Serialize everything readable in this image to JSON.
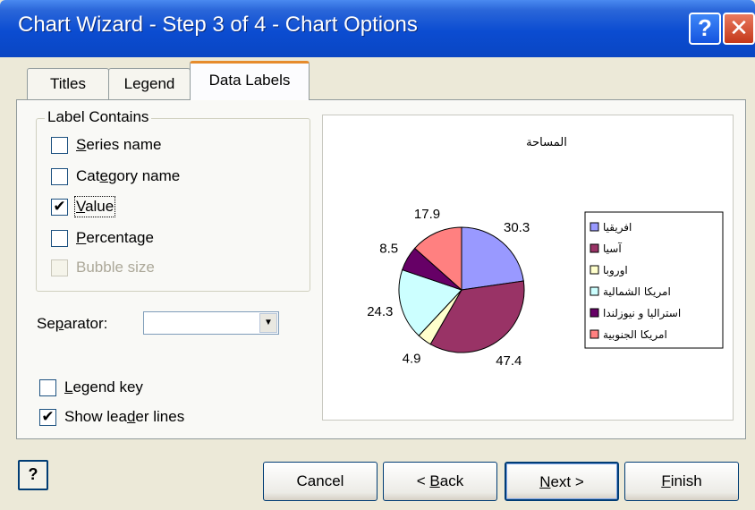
{
  "window": {
    "title": "Chart Wizard - Step 3 of 4 - Chart Options",
    "help_glyph": "?",
    "close_glyph": "✕"
  },
  "tabs": [
    {
      "label": "Titles",
      "active": false
    },
    {
      "label": "Legend",
      "active": false
    },
    {
      "label": "Data Labels",
      "active": true
    }
  ],
  "label_contains": {
    "title": "Label Contains",
    "options": [
      {
        "pre": "",
        "mn": "S",
        "post": "eries name",
        "checked": false,
        "enabled": true
      },
      {
        "pre": "Cat",
        "mn": "e",
        "post": "gory name",
        "checked": false,
        "enabled": true
      },
      {
        "pre": "",
        "mn": "V",
        "post": "alue",
        "checked": true,
        "enabled": true
      },
      {
        "pre": "",
        "mn": "P",
        "post": "ercentage",
        "checked": false,
        "enabled": true
      },
      {
        "pre": "Bubble size",
        "mn": "",
        "post": "",
        "checked": false,
        "enabled": false
      }
    ]
  },
  "separator": {
    "pre": "Se",
    "mn": "p",
    "post": "arator:",
    "value": ""
  },
  "legend_key": {
    "pre": "",
    "mn": "L",
    "post": "egend key",
    "checked": false
  },
  "leader_lines": {
    "pre": "Show lea",
    "mn": "d",
    "post": "er lines",
    "checked": true
  },
  "check_mark": "✔",
  "buttons": {
    "help_icon": "?",
    "cancel": "Cancel",
    "back": {
      "pre": "< ",
      "mn": "B",
      "post": "ack"
    },
    "next": {
      "pre": "",
      "mn": "N",
      "post": "ext >"
    },
    "finish": {
      "pre": "",
      "mn": "F",
      "post": "inish"
    }
  },
  "chart_data": {
    "type": "pie",
    "title": "المساحة",
    "categories": [
      "افريقيا",
      "آسيا",
      "اوروبا",
      "امريكا الشمالية",
      "استراليا و نيوزلندا",
      "امريكا الجنوبية"
    ],
    "values": [
      30.3,
      47.4,
      4.9,
      24.3,
      8.5,
      17.9
    ],
    "colors": [
      "#9999FF",
      "#993366",
      "#FFFFCC",
      "#CCFFFF",
      "#660066",
      "#FF8080"
    ],
    "data_labels": [
      "30.3",
      "47.4",
      "4.9",
      "24.3",
      "8.5",
      "17.9"
    ],
    "legend_position": "right"
  }
}
